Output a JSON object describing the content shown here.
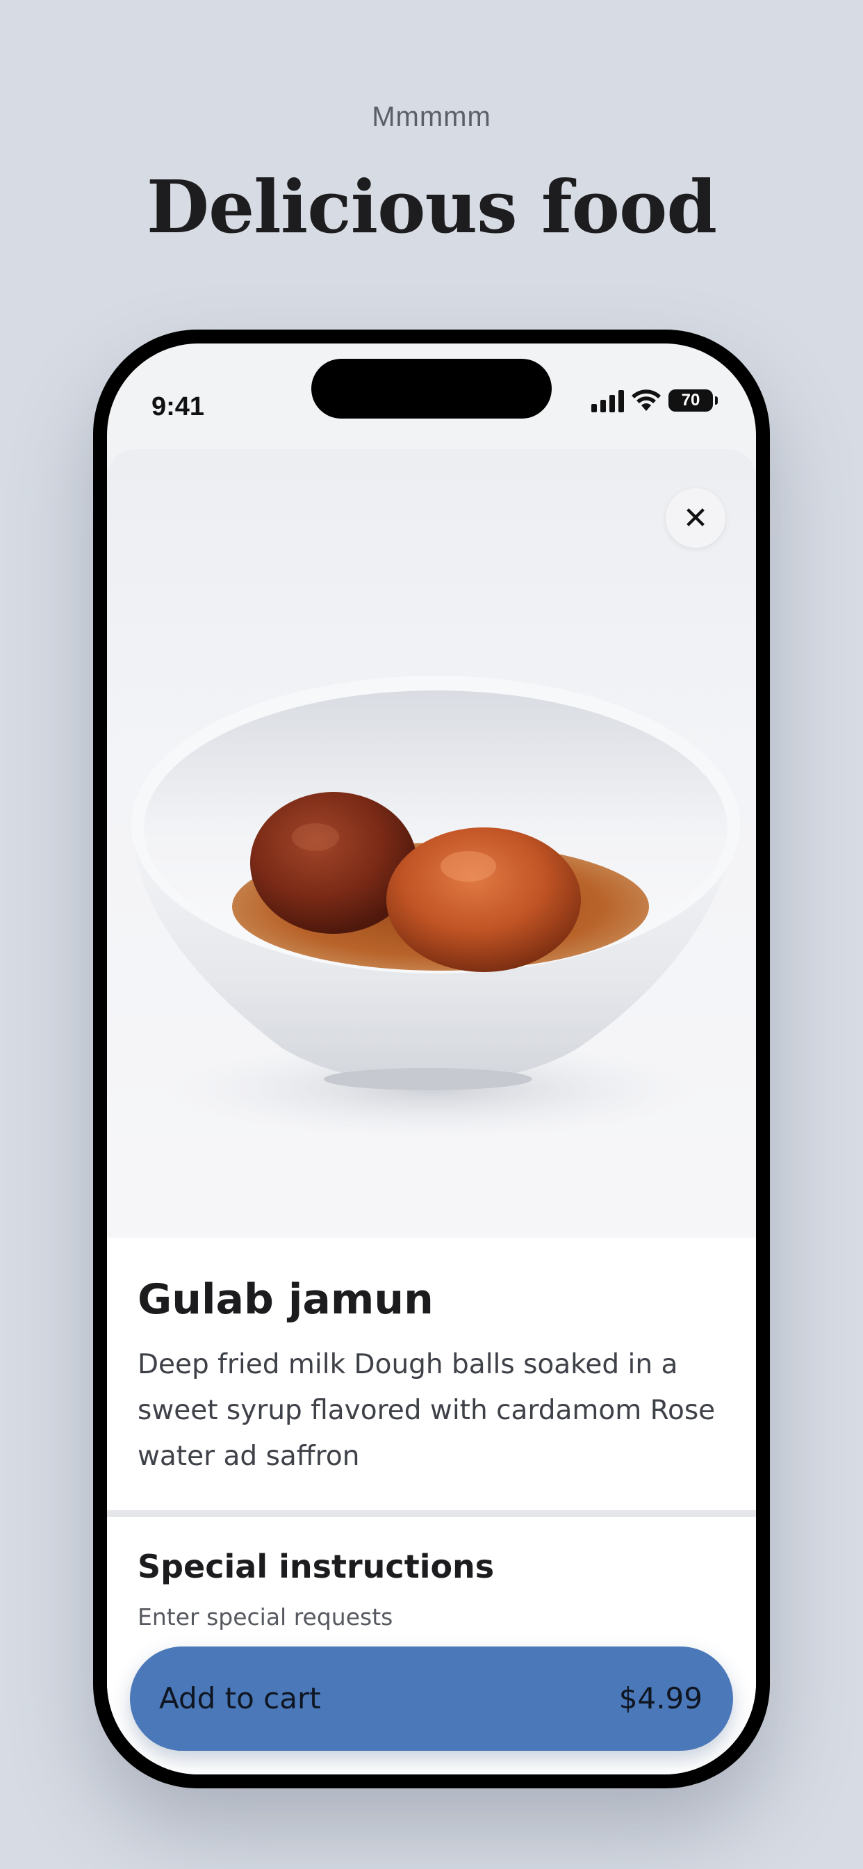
{
  "header": {
    "eyebrow": "Mmmmm",
    "title": "Delicious food"
  },
  "status_bar": {
    "time": "9:41",
    "battery": "70",
    "icons": [
      "cellular-signal-icon",
      "wifi-icon",
      "battery-icon"
    ]
  },
  "product": {
    "image": "gulab-jamun-bowl-image",
    "name": "Gulab jamun",
    "description": "Deep fried milk Dough balls soaked in a sweet syrup flavored with cardamom Rose water ad saffron"
  },
  "special_instructions": {
    "title": "Special instructions",
    "placeholder": "Enter special requests"
  },
  "cart_button": {
    "label": "Add to cart",
    "price": "$4.99",
    "color": "#4b78b9"
  },
  "close_icon": "close-icon"
}
